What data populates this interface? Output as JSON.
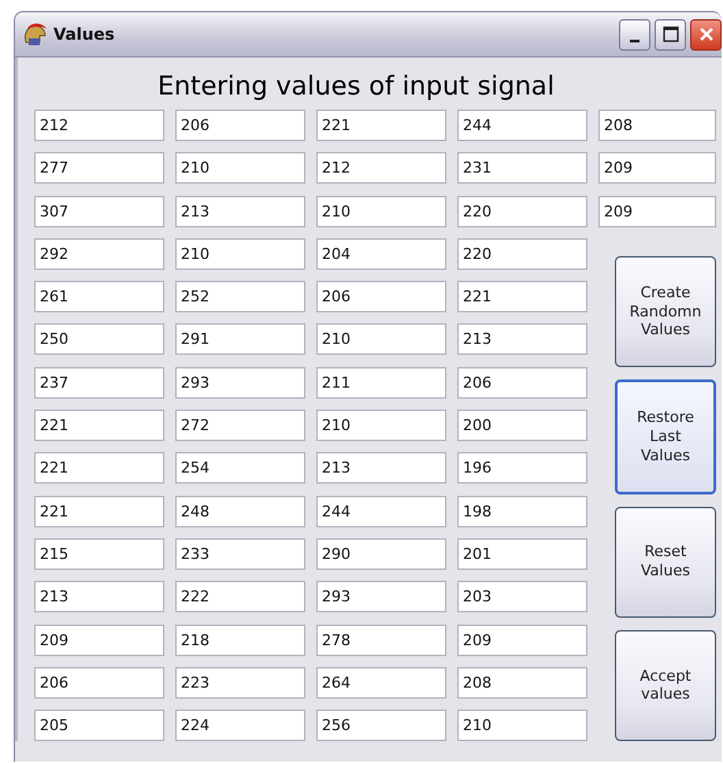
{
  "window": {
    "title": "Values"
  },
  "heading": "Entering values of input signal",
  "rows": [
    [
      "212",
      "206",
      "221",
      "244",
      "208"
    ],
    [
      "277",
      "210",
      "212",
      "231",
      "209"
    ],
    [
      "307",
      "213",
      "210",
      "220",
      "209"
    ],
    [
      "292",
      "210",
      "204",
      "220"
    ],
    [
      "261",
      "252",
      "206",
      "221"
    ],
    [
      "250",
      "291",
      "210",
      "213"
    ],
    [
      "237",
      "293",
      "211",
      "206"
    ],
    [
      "221",
      "272",
      "210",
      "200"
    ],
    [
      "221",
      "254",
      "213",
      "196"
    ],
    [
      "221",
      "248",
      "244",
      "198"
    ],
    [
      "215",
      "233",
      "290",
      "201"
    ],
    [
      "213",
      "222",
      "293",
      "203"
    ],
    [
      "209",
      "218",
      "278",
      "209"
    ],
    [
      "206",
      "223",
      "264",
      "208"
    ],
    [
      "205",
      "224",
      "256",
      "210"
    ]
  ],
  "buttons": [
    {
      "label": "Create\nRandomn\nValues",
      "focused": false
    },
    {
      "label": "Restore Last\nValues",
      "focused": true
    },
    {
      "label": "Reset\nValues",
      "focused": false
    },
    {
      "label": "Accept\nvalues",
      "focused": false
    }
  ]
}
